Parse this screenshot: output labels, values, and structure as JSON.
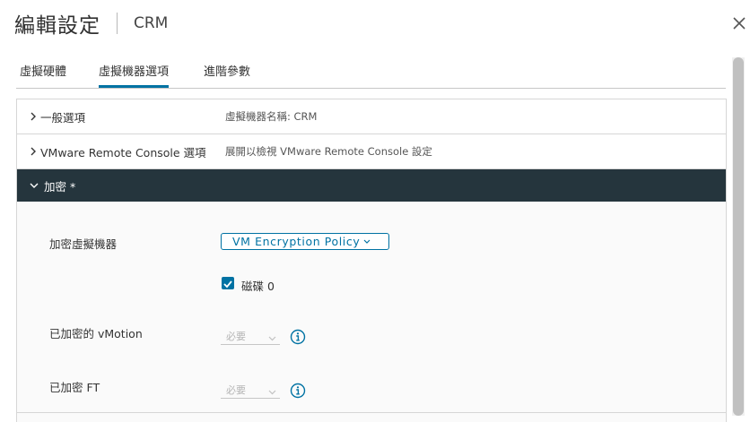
{
  "dialog": {
    "title": "編輯設定",
    "vm_name": "CRM",
    "close_icon": "close-icon"
  },
  "tabs": [
    {
      "label": "虛擬硬體",
      "active": false
    },
    {
      "label": "虛擬機器選項",
      "active": true
    },
    {
      "label": "進階參數",
      "active": false
    }
  ],
  "sections": {
    "general": {
      "label": "一般選項",
      "value": "虛擬機器名稱: CRM"
    },
    "vmrc": {
      "label": "VMware Remote Console 選項",
      "value": "展開以檢視 VMware Remote Console 設定"
    },
    "encryption": {
      "label": "加密 *"
    }
  },
  "encryption": {
    "encrypt_vm_label": "加密虛擬機器",
    "policy_value": "VM Encryption Policy",
    "disk_checkbox_label": "磁碟 0",
    "disk_checked": true,
    "vmotion_label": "已加密的 vMotion",
    "vmotion_value": "必要",
    "ft_label": "已加密 FT",
    "ft_value": "必要"
  },
  "colors": {
    "accent": "#0072a3",
    "band": "#25353d"
  }
}
